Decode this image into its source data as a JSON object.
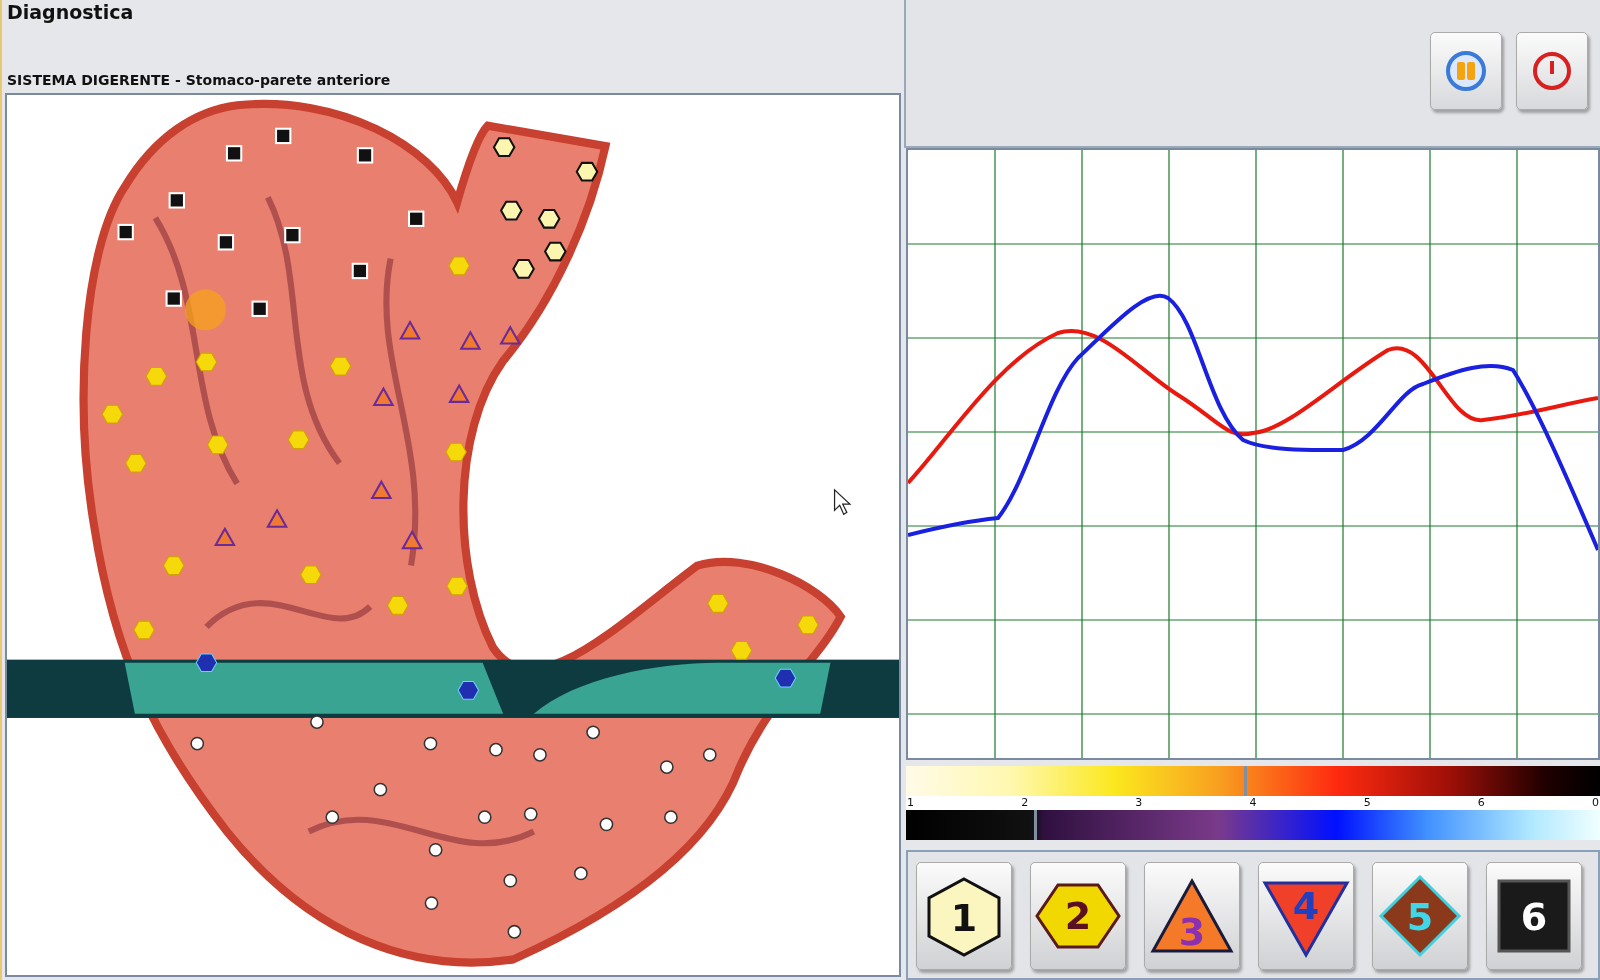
{
  "title": "Diagnostica",
  "subtitle": "SISTEMA DIGERENTE - Stomaco-parete anteriore",
  "scale": {
    "labels": [
      "1",
      "2",
      "3",
      "4",
      "5",
      "6",
      "0"
    ],
    "bars": [
      {
        "kind": "warm",
        "level": 0.487
      },
      {
        "kind": "cool",
        "level": 0.185
      }
    ]
  },
  "marker_buttons": [
    {
      "label": "1",
      "kind": "hexagon-light"
    },
    {
      "label": "2",
      "kind": "hexagon"
    },
    {
      "label": "3",
      "kind": "triangle"
    },
    {
      "label": "4",
      "kind": "triangle-down"
    },
    {
      "label": "5",
      "kind": "diamond"
    },
    {
      "label": "6",
      "kind": "square"
    }
  ]
}
